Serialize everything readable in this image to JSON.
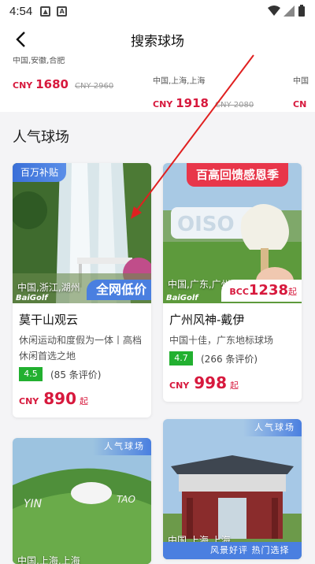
{
  "status": {
    "time": "4:54"
  },
  "header": {
    "title": "搜索球场"
  },
  "top_strip": [
    {
      "location": "中国,安徽,合肥",
      "cny": "CNY",
      "price": "1680",
      "old_price": "CNY 2960"
    },
    {
      "location": "中国,上海,上海",
      "cny": "CNY",
      "price": "1918",
      "old_price": "CNY 2080"
    },
    {
      "location": "中国",
      "cny": "CN",
      "price": "",
      "old_price": ""
    }
  ],
  "section": {
    "title": "人气球场"
  },
  "cards": [
    {
      "tag": "百万补贴",
      "location": "中国,浙江,湖州",
      "brand": "BaiGolf",
      "badge": "全网低价",
      "name": "莫干山观云",
      "desc": "休闲运动和度假为一体丨高档休闲首选之地",
      "score": "4.5",
      "reviews": "(85 条评价)",
      "cny": "CNY",
      "price": "890",
      "suffix": "起"
    },
    {
      "tag": "百高回馈感恩季",
      "location": "中国,广东,广州",
      "brand": "BaiGolf",
      "bcc_label": "BCC",
      "bcc_value": "1238",
      "bcc_suffix": "起",
      "name": "广州风神-戴伊",
      "desc": "中国十佳，广东地标球场",
      "score": "4.7",
      "reviews": "(266 条评价)",
      "cny": "CNY",
      "price": "998",
      "suffix": "起"
    },
    {
      "tag": "人气球场",
      "location": "中国,上海,上海"
    },
    {
      "tag": "人气球场",
      "location": "中国,上海,上海",
      "band": "风景好评  热门选择"
    }
  ],
  "colors": {
    "accent": "#d7193d",
    "blue": "#4a7fe0",
    "green": "#22b030",
    "arrow": "#e02020"
  }
}
